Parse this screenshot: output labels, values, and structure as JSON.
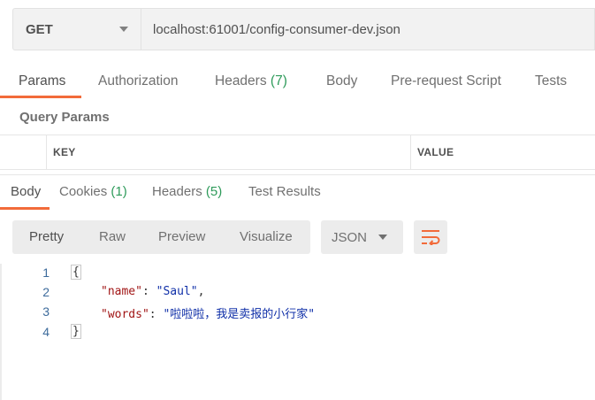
{
  "request": {
    "method": "GET",
    "url": "localhost:61001/config-consumer-dev.json"
  },
  "request_tabs": [
    {
      "label": "Params",
      "count": ""
    },
    {
      "label": "Authorization",
      "count": ""
    },
    {
      "label": "Headers",
      "count": "(7)"
    },
    {
      "label": "Body",
      "count": ""
    },
    {
      "label": "Pre-request Script",
      "count": ""
    },
    {
      "label": "Tests",
      "count": ""
    }
  ],
  "query_params": {
    "title": "Query Params",
    "columns": [
      "KEY",
      "VALUE"
    ]
  },
  "response_tabs": [
    {
      "label": "Body",
      "count": ""
    },
    {
      "label": "Cookies",
      "count": "(1)"
    },
    {
      "label": "Headers",
      "count": "(5)"
    },
    {
      "label": "Test Results",
      "count": ""
    }
  ],
  "view_modes": [
    "Pretty",
    "Raw",
    "Preview",
    "Visualize"
  ],
  "format": "JSON",
  "code_lines": [
    {
      "num": "1",
      "text": "{"
    },
    {
      "num": "2",
      "key": "\"name\"",
      "value": "\"Saul\"",
      "trail": ","
    },
    {
      "num": "3",
      "key": "\"words\"",
      "value": "\"啦啦啦，我是卖报的小行家\"",
      "trail": ""
    },
    {
      "num": "4",
      "text": "}"
    }
  ],
  "colors": {
    "accent": "#f26b3a",
    "count": "#2f9b5b",
    "json_key": "#a11515",
    "json_string": "#0f2fa8"
  }
}
